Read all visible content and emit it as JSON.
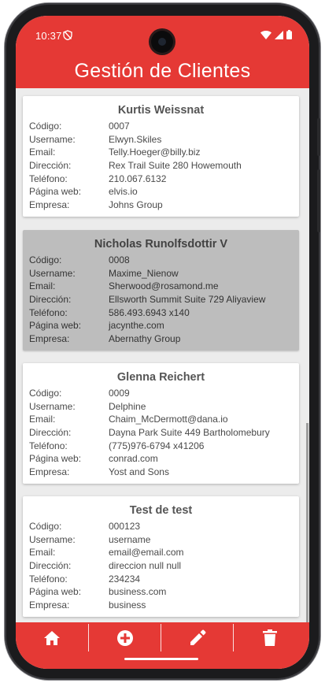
{
  "status": {
    "time": "10:37",
    "shield_icon": "shield-off-icon",
    "wifi_icon": "wifi-icon",
    "signal_icon": "cell-signal-icon",
    "battery_icon": "battery-icon"
  },
  "appbar": {
    "title": "Gestión de Clientes"
  },
  "labels": {
    "codigo": "Código:",
    "username": "Username:",
    "email": "Email:",
    "direccion": "Dirección:",
    "telefono": "Teléfono:",
    "web": "Página web:",
    "empresa": "Empresa:"
  },
  "clients": [
    {
      "name": "Kurtis Weissnat",
      "codigo": "0007",
      "username": "Elwyn.Skiles",
      "email": "Telly.Hoeger@billy.biz",
      "direccion": "Rex Trail Suite 280 Howemouth",
      "telefono": "210.067.6132",
      "web": "elvis.io",
      "empresa": "Johns Group",
      "selected": false
    },
    {
      "name": "Nicholas Runolfsdottir V",
      "codigo": "0008",
      "username": "Maxime_Nienow",
      "email": "Sherwood@rosamond.me",
      "direccion": "Ellsworth Summit Suite 729 Aliyaview",
      "telefono": "586.493.6943 x140",
      "web": "jacynthe.com",
      "empresa": "Abernathy Group",
      "selected": true
    },
    {
      "name": "Glenna Reichert",
      "codigo": "0009",
      "username": "Delphine",
      "email": "Chaim_McDermott@dana.io",
      "direccion": "Dayna Park Suite 449 Bartholomebury",
      "telefono": "(775)976-6794 x41206",
      "web": "conrad.com",
      "empresa": "Yost and Sons",
      "selected": false
    },
    {
      "name": "Test de test",
      "codigo": "000123",
      "username": "username",
      "email": "email@email.com",
      "direccion": "direccion null null",
      "telefono": "234234",
      "web": "business.com",
      "empresa": "business",
      "selected": false
    }
  ],
  "bottom_nav": [
    {
      "icon": "home-icon"
    },
    {
      "icon": "add-circle-icon"
    },
    {
      "icon": "edit-pencil-icon"
    },
    {
      "icon": "delete-trash-icon"
    }
  ],
  "colors": {
    "primary": "#e53935",
    "background": "#ececec",
    "card": "#ffffff",
    "card_selected": "#bdbdbd"
  }
}
